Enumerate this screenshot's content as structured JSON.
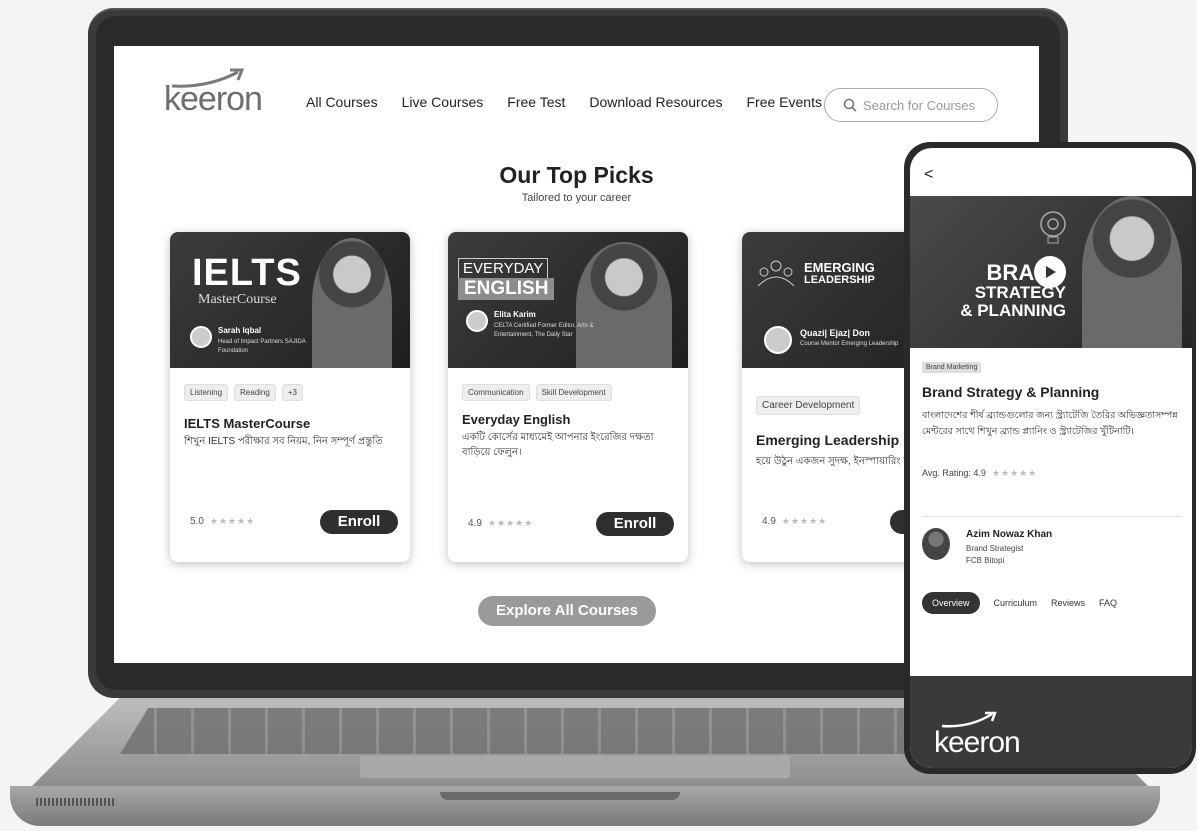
{
  "brand": {
    "logo": "keeron"
  },
  "nav": {
    "items": [
      "All Courses",
      "Live Courses",
      "Free Test",
      "Download Resources",
      "Free Events"
    ],
    "search_placeholder": "Search for Courses"
  },
  "section": {
    "title": "Our Top Picks",
    "subtitle": "Tailored to your career"
  },
  "cards": [
    {
      "banner_title": "IELTS",
      "banner_subtitle": "MasterCourse",
      "mentor_name": "Sarah Iqbal",
      "mentor_role": "Head of Impact Partners SAJIDA Foundation",
      "tags": [
        "Listening",
        "Reading",
        "+3"
      ],
      "title": "IELTS MasterCourse",
      "desc": "শিখুন IELTS পরীক্ষার সব নিয়ম, নিন সম্পূর্ণ প্রস্তুতি",
      "rating": "5.0",
      "enroll": "Enroll"
    },
    {
      "banner_title_top": "EVERYDAY",
      "banner_title": "ENGLISH",
      "mentor_name": "Elita Karim",
      "mentor_role": "CELTA Certified Former Editor, Arts & Entertainment, The Daily Star",
      "tags": [
        "Communication",
        "Skill Development"
      ],
      "title": "Everyday English",
      "desc": "একটি কোর্সের মাধ্যমেই আপনার ইংরেজির দক্ষতা বাড়িয়ে ফেলুন।",
      "rating": "4.9",
      "enroll": "Enroll"
    },
    {
      "banner_title_top": "EMERGING",
      "banner_title": "LEADERSHIP",
      "mentor_name": "Quazi| Ejaz| Don",
      "mentor_role": "Course Mentor Emerging Leadership",
      "tags": [
        "Career Development"
      ],
      "title": "Emerging Leadership",
      "desc": "হয়ে উঠুন একজন সুদক্ষ, ইনস্পায়ারিং ম্যানেজার",
      "rating": "4.9",
      "enroll": "Enroll"
    }
  ],
  "explore": "Explore All Courses",
  "phone": {
    "back": "<",
    "banner_lines": [
      "BRAND",
      "STRATEGY",
      "& PLANNING"
    ],
    "tag": "Brand Marketing",
    "title": "Brand Strategy & Planning",
    "desc": "বাংলাদেশের শীর্ষ ব্র্যান্ডগুলোর জন্য স্ট্র্যাটেজি তৈরির অভিজ্ঞতাসম্পন্ন মেন্টরের সাথে শিখুন ব্র্যান্ড প্ল্যানিং ও স্ট্র্যাটেজির খুঁটিনাটি।",
    "rating_label": "Avg. Rating: 4.9",
    "mentor_name": "Azim Nowaz Khan",
    "mentor_role1": "Brand Strategist",
    "mentor_role2": "FCB Bitopi",
    "tabs": [
      "Overview",
      "Curriculum",
      "Reviews",
      "FAQ"
    ],
    "logo": "keeron"
  }
}
